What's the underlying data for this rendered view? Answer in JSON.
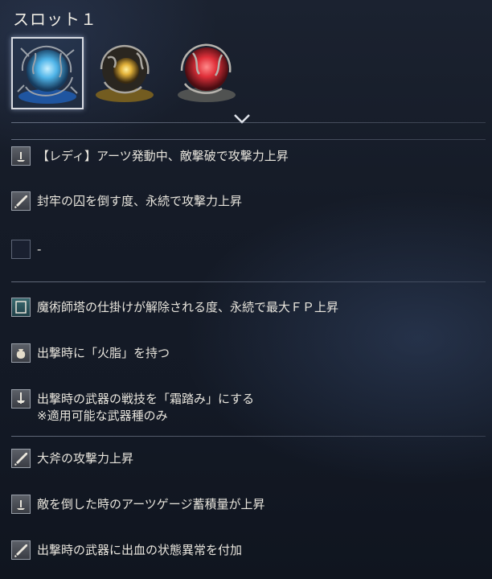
{
  "slot": {
    "title": "スロット１"
  },
  "relics": [
    {
      "name": "blue-relic",
      "color": "#4fb4e8",
      "selected": true
    },
    {
      "name": "yellow-relic",
      "color": "#e3b23a",
      "selected": false
    },
    {
      "name": "red-relic",
      "color": "#e0303a",
      "selected": false
    }
  ],
  "effects": [
    {
      "icon": "arts-icon",
      "text": "【レディ】アーツ発動中、敵撃破で攻撃力上昇"
    },
    {
      "icon": "sword-icon",
      "text": "封牢の囚を倒す度、永続で攻撃力上昇"
    },
    {
      "icon": "empty-icon",
      "text": "-"
    },
    {
      "icon": "book-icon",
      "text": "魔術師塔の仕掛けが解除される度、永続で最大ＦＰ上昇"
    },
    {
      "icon": "pouch-icon",
      "text": "出撃時に「火脂」を持つ"
    },
    {
      "icon": "skill-icon",
      "text": "出撃時の武器の戦技を「霜踏み」にする",
      "text2": "※適用可能な武器種のみ"
    },
    {
      "icon": "sword-icon",
      "text": "大斧の攻撃力上昇"
    },
    {
      "icon": "arts-icon",
      "text": "敵を倒した時のアーツゲージ蓄積量が上昇"
    },
    {
      "icon": "sword-icon",
      "text": "出撃時の武器に出血の状態異常を付加"
    }
  ]
}
